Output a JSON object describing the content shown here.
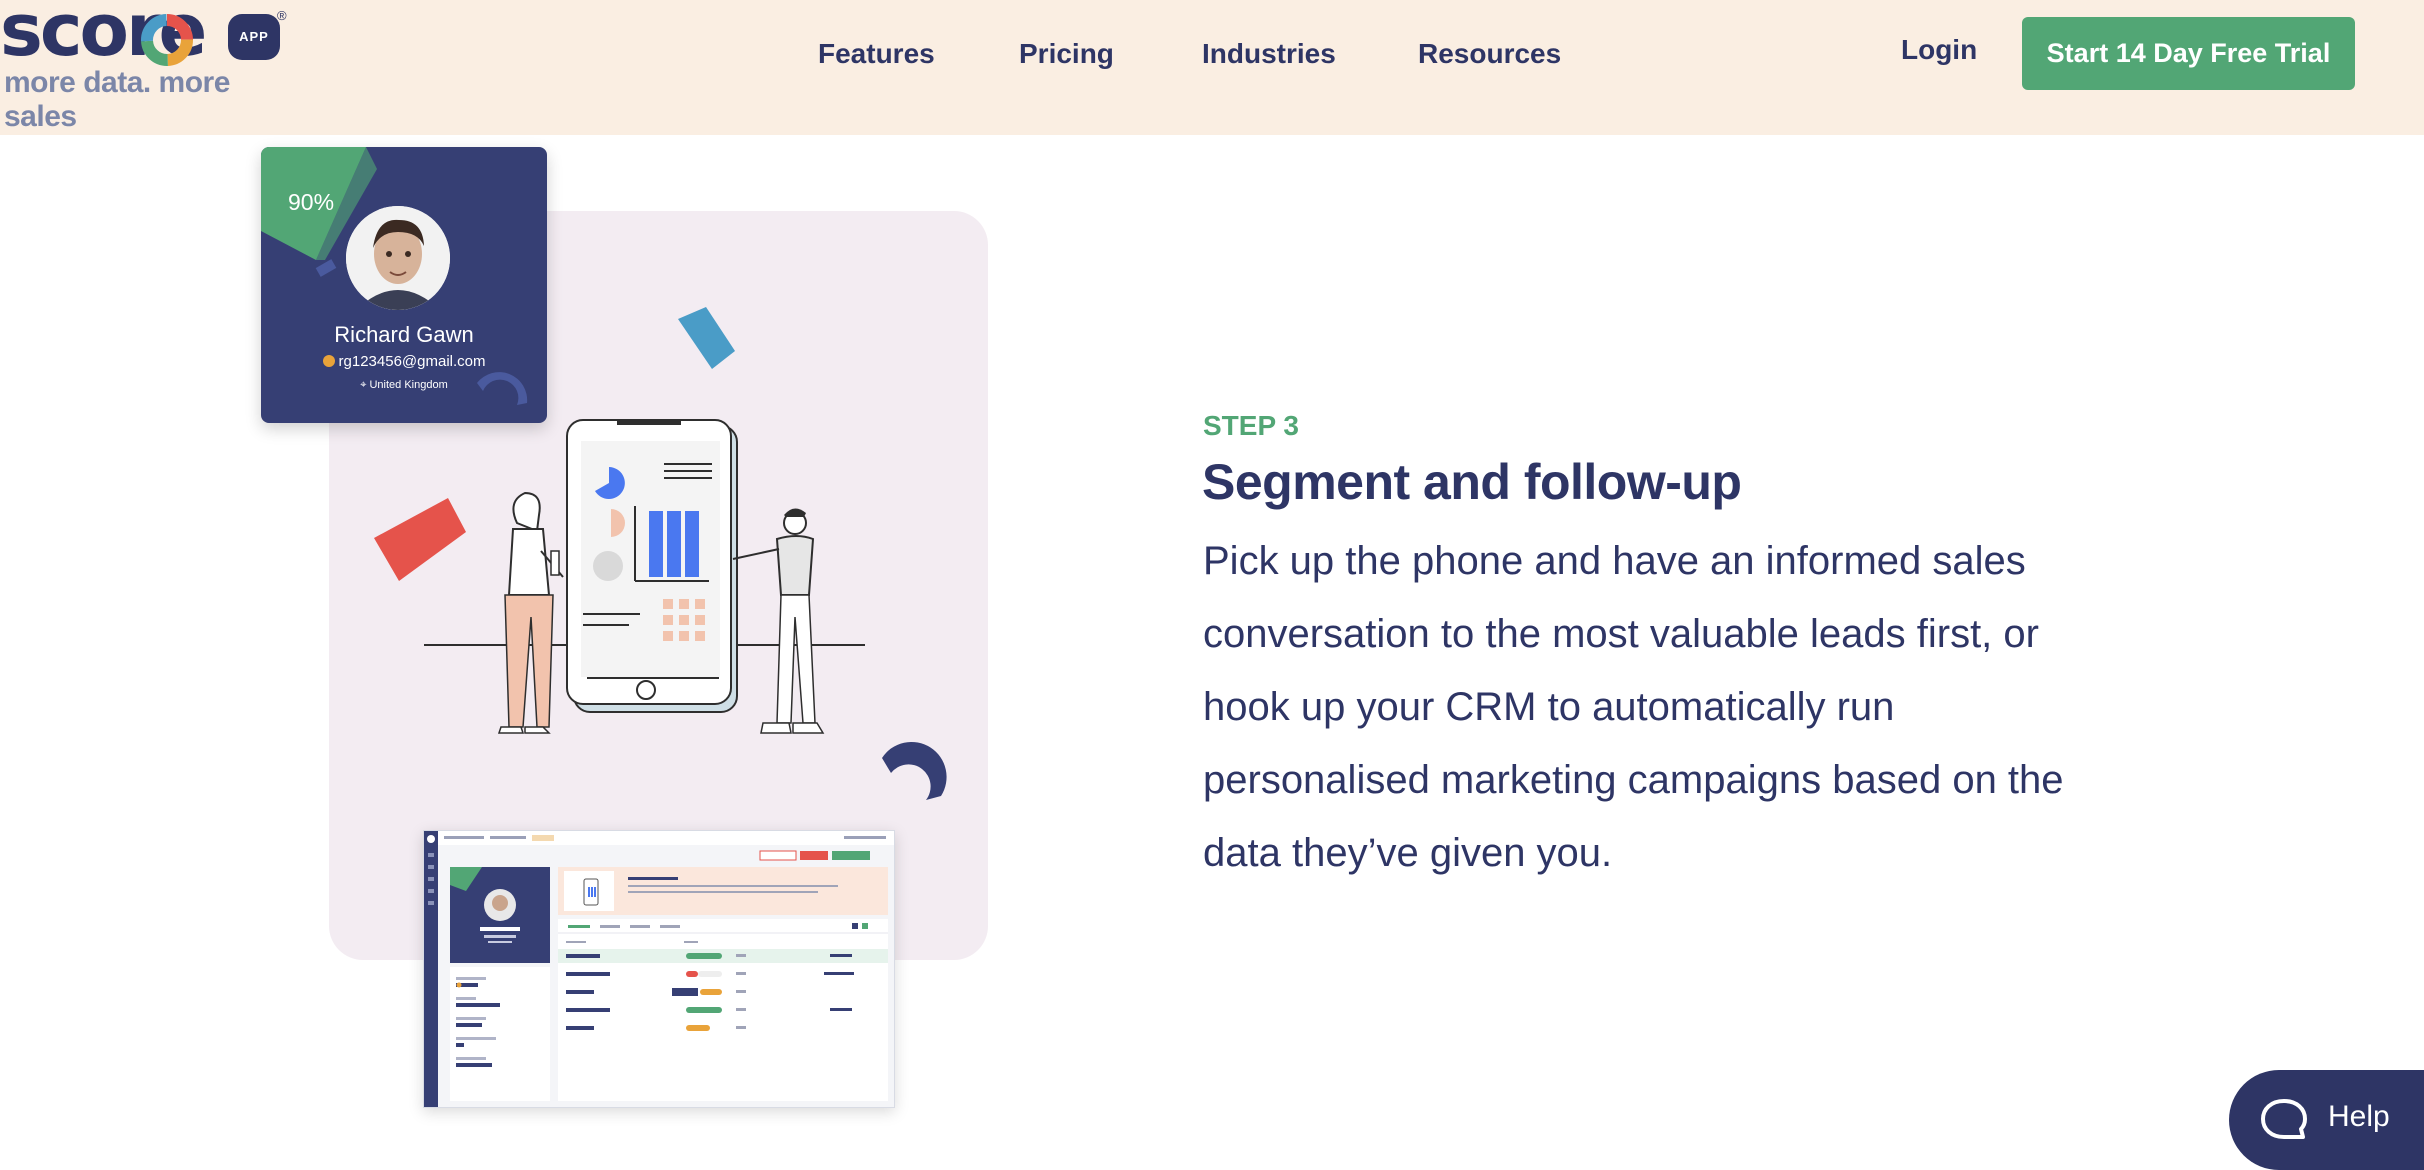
{
  "brand": {
    "name": "score",
    "badge": "APP",
    "registered": "®",
    "tagline": "more data. more sales"
  },
  "nav": {
    "items": [
      {
        "label": "Features"
      },
      {
        "label": "Pricing"
      },
      {
        "label": "Industries"
      },
      {
        "label": "Resources"
      }
    ],
    "login": "Login",
    "cta": "Start 14 Day Free Trial"
  },
  "colors": {
    "header_bg": "#faeee2",
    "navy": "#2e3565",
    "green": "#52a675",
    "illustration_bg": "#f3ecf2"
  },
  "profile_card": {
    "score": "90%",
    "name": "Richard Gawn",
    "email": "rg123456@gmail.com",
    "location": "United Kingdom"
  },
  "step": {
    "label": "STEP 3",
    "title": "Segment and follow-up",
    "body": "Pick up the phone and have an informed sales conversation to the most valuable leads first, or hook up your CRM to automatically run personalised marketing campaigns based on the data they’ve given you."
  },
  "help": {
    "label": "Help",
    "icon": "chat-bubble-icon"
  }
}
